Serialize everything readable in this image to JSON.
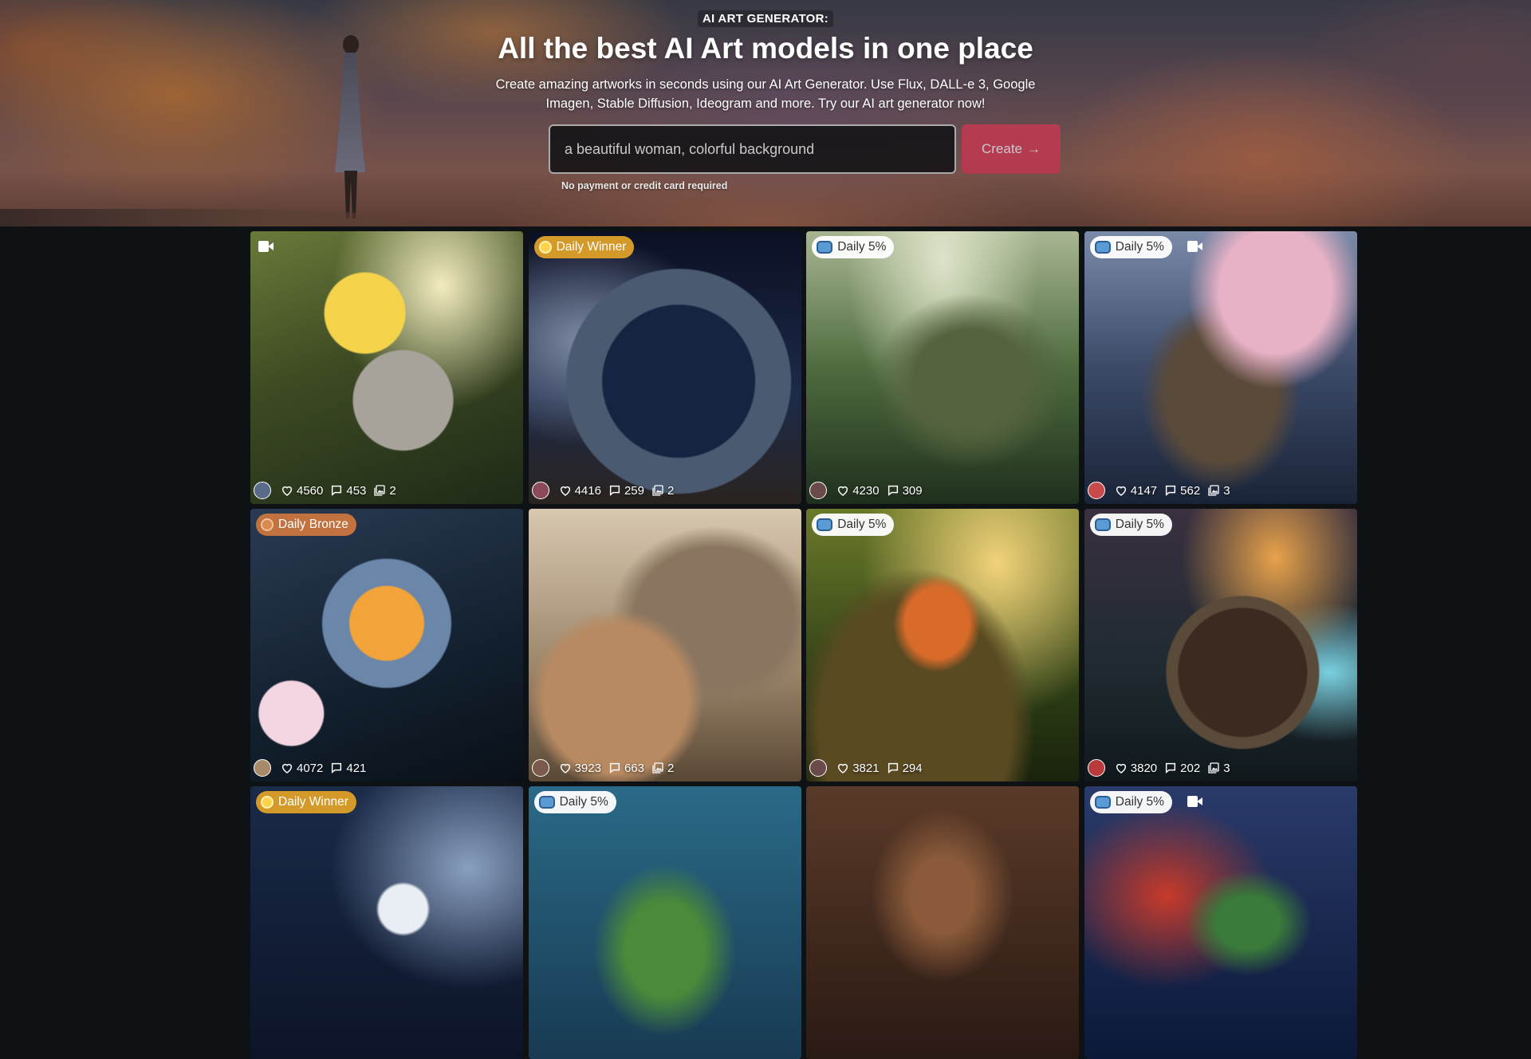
{
  "hero": {
    "kicker": "AI ART GENERATOR:",
    "title": "All the best AI Art models in one place",
    "subtitle": "Create amazing artworks in seconds using our AI Art Generator. Use Flux, DALL-e 3, Google Imagen, Stable Diffusion, Ideogram and more. Try our AI art generator now!",
    "search_value": "a beautiful woman, colorful background",
    "create_label": "Create",
    "create_arrow": "→",
    "note": "No payment or credit card required"
  },
  "cards": [
    {
      "badge": "",
      "video": true,
      "likes": "4560",
      "comments": "453",
      "images": "2",
      "avatar_color": "#5a6a8a"
    },
    {
      "badge": "Daily Winner",
      "video": false,
      "likes": "4416",
      "comments": "259",
      "images": "2",
      "avatar_color": "#8a4a5a"
    },
    {
      "badge": "Daily 5%",
      "video": false,
      "likes": "4230",
      "comments": "309",
      "images": "",
      "avatar_color": "#6a4a4a"
    },
    {
      "badge": "Daily 5%",
      "video": true,
      "likes": "4147",
      "comments": "562",
      "images": "3",
      "avatar_color": "#c84a4a"
    },
    {
      "badge": "Daily Bronze",
      "video": false,
      "likes": "4072",
      "comments": "421",
      "images": "",
      "avatar_color": "#a88a6a"
    },
    {
      "badge": "",
      "video": false,
      "likes": "3923",
      "comments": "663",
      "images": "2",
      "avatar_color": "#7a5a4a"
    },
    {
      "badge": "Daily 5%",
      "video": false,
      "likes": "3821",
      "comments": "294",
      "images": "",
      "avatar_color": "#6a4a4a"
    },
    {
      "badge": "Daily 5%",
      "video": false,
      "likes": "3820",
      "comments": "202",
      "images": "3",
      "avatar_color": "#b83a3a"
    },
    {
      "badge": "Daily Winner",
      "video": false,
      "likes": "",
      "comments": "",
      "images": ""
    },
    {
      "badge": "Daily 5%",
      "video": false,
      "likes": "",
      "comments": "",
      "images": ""
    },
    {
      "badge": "",
      "video": false,
      "likes": "",
      "comments": "",
      "images": ""
    },
    {
      "badge": "Daily 5%",
      "video": true,
      "likes": "",
      "comments": "",
      "images": ""
    }
  ],
  "colors": {
    "accent": "#e64b66",
    "winner": "#d39a2a",
    "bronze": "#c2723e",
    "page_bg": "#0e1214"
  },
  "icons": {
    "like": "heart-icon",
    "comment": "comment-icon",
    "images": "images-icon",
    "video": "video-camera-icon",
    "medal": "medal-icon",
    "robot": "robot-icon"
  }
}
